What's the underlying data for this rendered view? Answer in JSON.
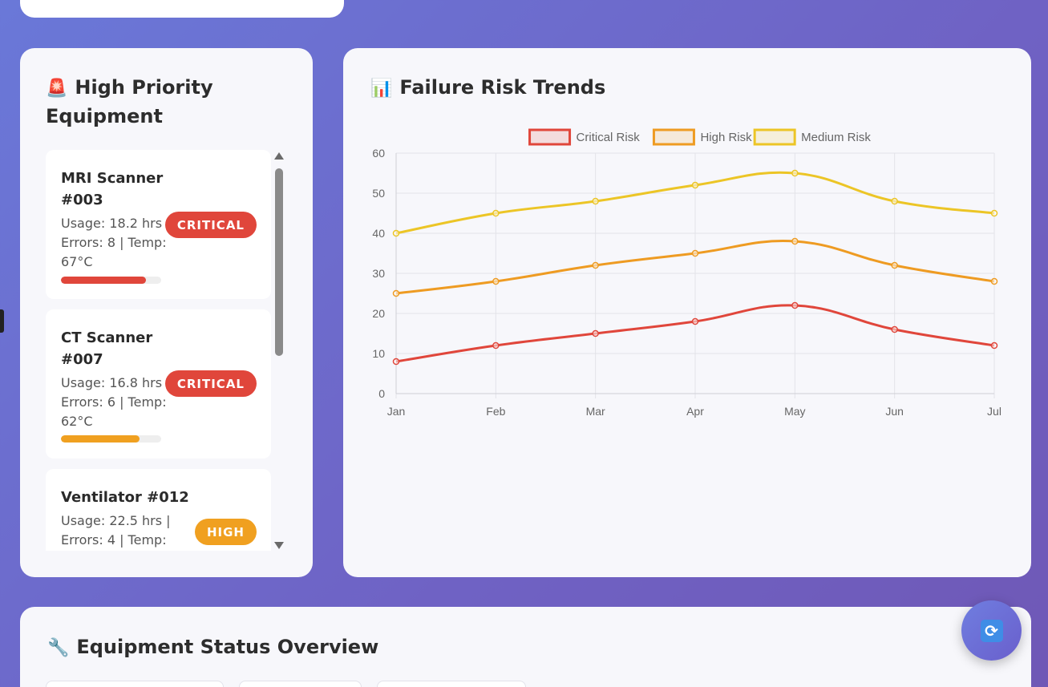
{
  "high_priority": {
    "title": "High Priority Equipment",
    "icon": "alarm-siren-icon",
    "items": [
      {
        "name": "MRI Scanner #003",
        "meta": "Usage: 18.2 hrs | Errors: 8 | Temp: 67°C",
        "status": "CRITICAL",
        "status_color": "#e0463b",
        "risk_level": 0.85,
        "bar_color": "#e0463b"
      },
      {
        "name": "CT Scanner #007",
        "meta": "Usage: 16.8 hrs | Errors: 6 | Temp: 62°C",
        "status": "CRITICAL",
        "status_color": "#e0463b",
        "risk_level": 0.78,
        "bar_color": "#f0a020"
      },
      {
        "name": "Ventilator #012",
        "meta": "Usage: 22.5 hrs | Errors: 4 | Temp:",
        "status": "HIGH",
        "status_color": "#f0a020"
      }
    ]
  },
  "trends": {
    "title": "Failure Risk Trends",
    "icon": "bar-chart-icon"
  },
  "chart_data": {
    "type": "line",
    "categories": [
      "Jan",
      "Feb",
      "Mar",
      "Apr",
      "May",
      "Jun",
      "Jul"
    ],
    "series": [
      {
        "name": "Critical Risk",
        "color": "#e0463b",
        "values": [
          8,
          12,
          15,
          18,
          22,
          16,
          12
        ]
      },
      {
        "name": "High Risk",
        "color": "#ee9b22",
        "values": [
          25,
          28,
          32,
          35,
          38,
          32,
          28
        ]
      },
      {
        "name": "Medium Risk",
        "color": "#ecc526",
        "values": [
          40,
          45,
          48,
          52,
          55,
          48,
          45
        ]
      }
    ],
    "ylim": [
      0,
      60
    ],
    "yticks": [
      0,
      10,
      20,
      30,
      40,
      50,
      60
    ],
    "grid": true,
    "legend": "top-center"
  },
  "status_overview": {
    "title": "Equipment Status Overview",
    "icon": "wrench-icon"
  },
  "refresh": {
    "icon": "refresh-icon"
  }
}
